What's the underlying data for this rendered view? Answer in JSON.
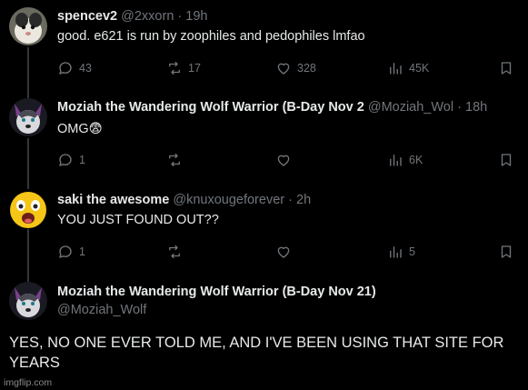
{
  "tweets": [
    {
      "name": "spencev2",
      "handle": "@2xxorn",
      "dot": "·",
      "time": "19h",
      "text": "good. e621 is run by zoophiles and pedophiles lmfao",
      "replies": "43",
      "reposts": "17",
      "likes": "328",
      "views": "45K"
    },
    {
      "name": "Moziah the Wandering Wolf Warrior (B-Day Nov 2",
      "handle": "@Moziah_Wol",
      "dot": "·",
      "time": "18h",
      "text": "OMG😨",
      "replies": "1",
      "reposts": "",
      "likes": "",
      "views": "6K"
    },
    {
      "name": "saki the awesome",
      "handle": "@knuxougeforever",
      "dot": "·",
      "time": "2h",
      "text": "YOU JUST FOUND OUT??",
      "replies": "1",
      "reposts": "",
      "likes": "",
      "views": "5"
    },
    {
      "name": "Moziah the Wandering Wolf Warrior (B-Day Nov 21)",
      "handle": "@Moziah_Wolf",
      "text": "YES, NO ONE EVER TOLD ME, AND I'VE BEEN USING THAT SITE FOR YEARS"
    }
  ],
  "watermark": "imgflip.com",
  "icons": {
    "reply": "reply-icon",
    "repost": "repost-icon",
    "like": "heart-icon",
    "views": "views-icon",
    "bookmark": "bookmark-icon"
  },
  "colors": {
    "background": "#000000",
    "text": "#e7e9ea",
    "muted": "#71767b",
    "thread_line": "#333639"
  }
}
